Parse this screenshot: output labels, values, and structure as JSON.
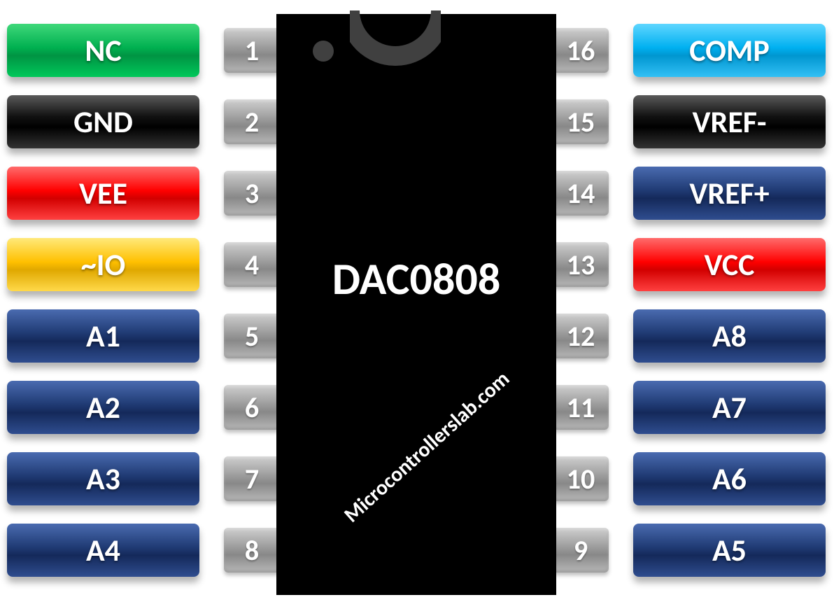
{
  "chip": {
    "name": "DAC0808",
    "watermark": "Microcontrollerslab.com"
  },
  "colors": {
    "green": "c-green",
    "black": "c-black",
    "red": "c-red",
    "yellow": "c-yellow",
    "navy": "c-navy",
    "cyan": "c-cyan"
  },
  "left_pins": [
    {
      "num": "1",
      "label": "NC",
      "color": "green"
    },
    {
      "num": "2",
      "label": "GND",
      "color": "black"
    },
    {
      "num": "3",
      "label": "VEE",
      "color": "red"
    },
    {
      "num": "4",
      "label": "~IO",
      "color": "yellow"
    },
    {
      "num": "5",
      "label": "A1",
      "color": "navy"
    },
    {
      "num": "6",
      "label": "A2",
      "color": "navy"
    },
    {
      "num": "7",
      "label": "A3",
      "color": "navy"
    },
    {
      "num": "8",
      "label": "A4",
      "color": "navy"
    }
  ],
  "right_pins": [
    {
      "num": "16",
      "label": "COMP",
      "color": "cyan"
    },
    {
      "num": "15",
      "label": "VREF-",
      "color": "black"
    },
    {
      "num": "14",
      "label": "VREF+",
      "color": "navy"
    },
    {
      "num": "13",
      "label": "VCC",
      "color": "red"
    },
    {
      "num": "12",
      "label": "A8",
      "color": "navy"
    },
    {
      "num": "11",
      "label": "A7",
      "color": "navy"
    },
    {
      "num": "10",
      "label": "A6",
      "color": "navy"
    },
    {
      "num": "9",
      "label": "A5",
      "color": "navy"
    }
  ]
}
